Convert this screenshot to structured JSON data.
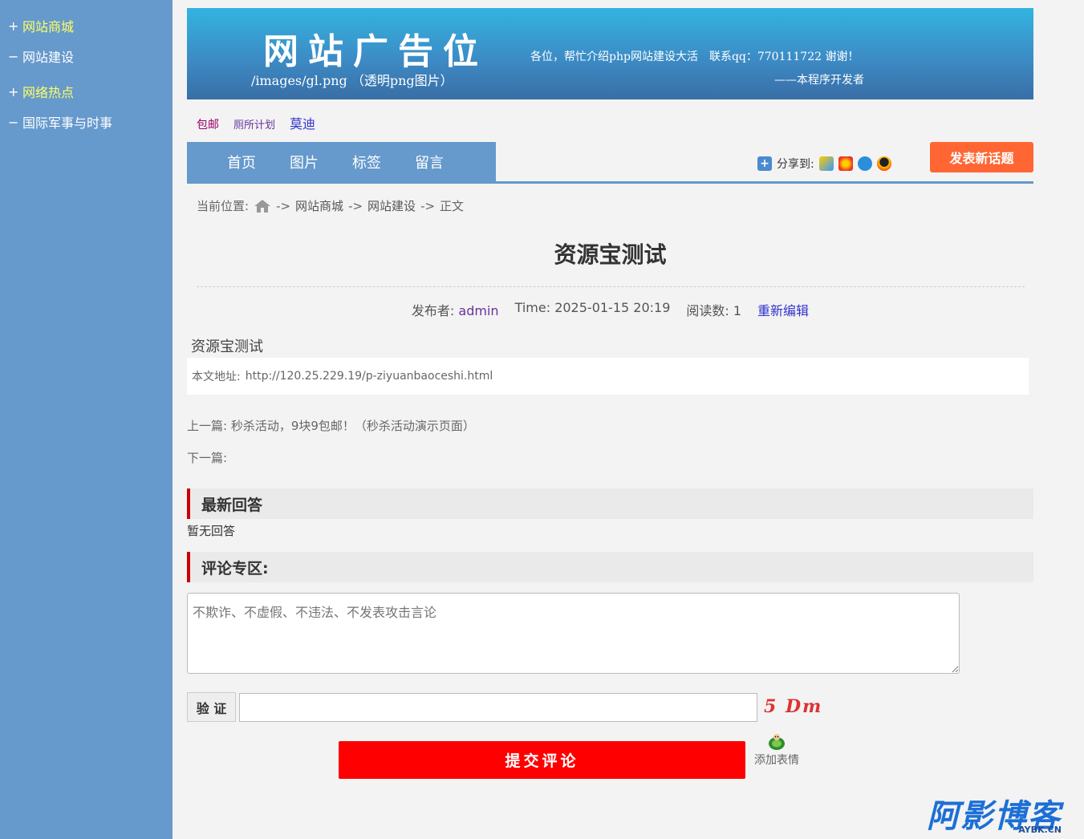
{
  "sidebar": {
    "items": [
      {
        "symbol": "+",
        "label": "网站商城",
        "highlight": true
      },
      {
        "symbol": "−",
        "label": "网站建设",
        "highlight": false
      },
      {
        "symbol": "+",
        "label": "网络热点",
        "highlight": true
      },
      {
        "symbol": "−",
        "label": "国际军事与时事",
        "highlight": false
      }
    ]
  },
  "banner": {
    "title": "网站广告位",
    "path": "/images/gl.png （透明png图片）",
    "message": "各位，帮忙介绍php网站建设大活　联系qq：770111722 谢谢！",
    "signature": "——本程序开发者"
  },
  "quick_links": [
    "包邮",
    "厕所计划",
    "莫迪"
  ],
  "nav": {
    "items": [
      "首页",
      "图片",
      "标签",
      "留言"
    ],
    "share_label": "分享到:",
    "share_icons": [
      "qzone-icon",
      "weibo-icon",
      "tencent-weibo-icon",
      "qq-icon"
    ],
    "post_button": "发表新话题"
  },
  "breadcrumb": {
    "prefix": "当前位置:",
    "sep": "->",
    "items": [
      "网站商城",
      "网站建设",
      "正文"
    ]
  },
  "article": {
    "title": "资源宝测试",
    "author_label": "发布者:",
    "author": "admin",
    "time": "Time: 2025-01-15 20:19",
    "reads": "阅读数: 1",
    "edit": "重新编辑",
    "body": "资源宝测试",
    "url_label": "本文地址:",
    "url": "http://120.25.229.19/p-ziyuanbaoceshi.html",
    "prev": "上一篇: 秒杀活动，9块9包邮！（秒杀活动演示页面）",
    "next": "下一篇:"
  },
  "answers": {
    "heading": "最新回答",
    "empty": "暂无回答"
  },
  "comments": {
    "heading": "评论专区:",
    "placeholder": "不欺诈、不虚假、不违法、不发表攻击言论",
    "verify_label": "验 证",
    "captcha": "5 Dm",
    "submit": "提交评论",
    "emoji_label": "添加表情"
  },
  "watermark": {
    "main": "阿影博客",
    "sub": "AYBK.CN"
  },
  "colors": {
    "sidebar": "#6699cc",
    "accent_red": "#ff0000",
    "post_button": "#ff6633",
    "highlight_text": "#ffff66"
  }
}
